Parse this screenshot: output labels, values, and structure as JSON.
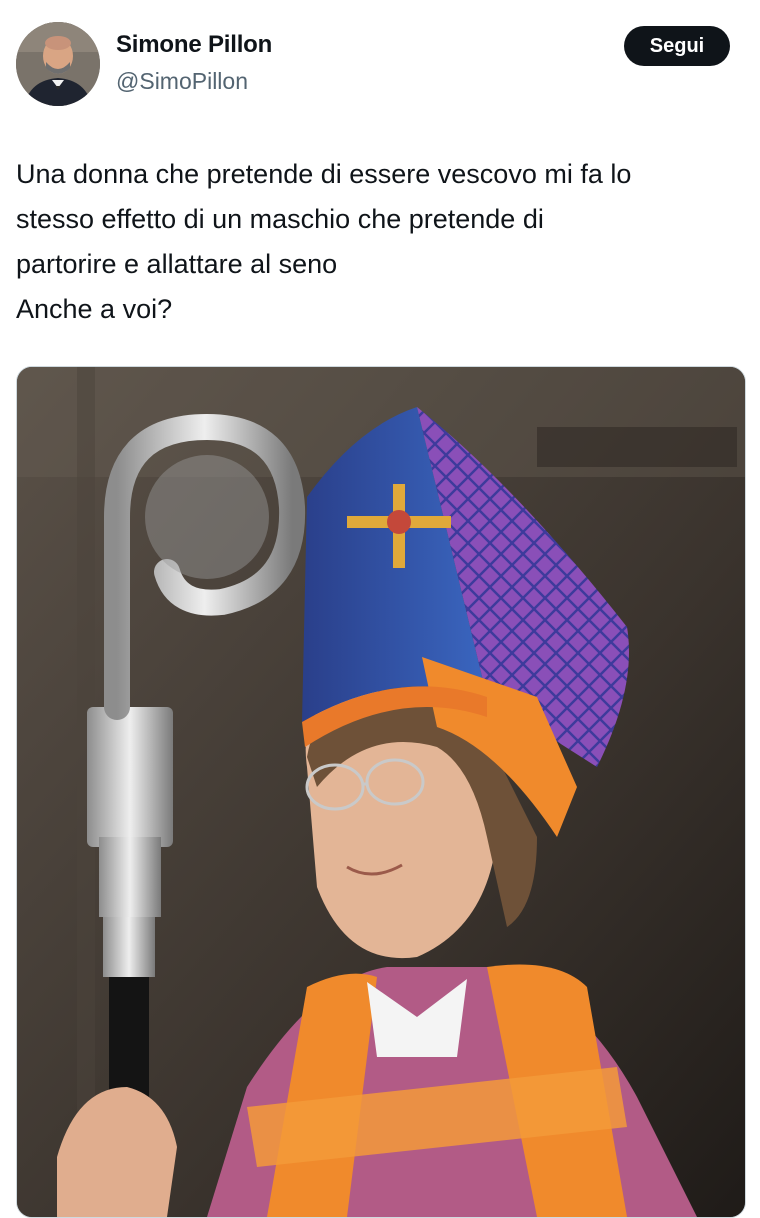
{
  "author": {
    "display_name": "Simone Pillon",
    "handle": "@SimoPillon"
  },
  "follow_button": {
    "label": "Segui"
  },
  "tweet": {
    "lines": [
      "Una donna che pretende di essere vescovo mi fa lo",
      "stesso effetto di un maschio che pretende di",
      "partorire e allattare al seno",
      "Anche a voi?"
    ]
  },
  "colors": {
    "text": "#0f1419",
    "secondary_text": "#536471",
    "follow_button_bg": "#0f1419",
    "mitre_blue": "#2f4f9e",
    "mitre_purple": "#7b3fa6",
    "vestment_orange": "#f08a2c"
  }
}
